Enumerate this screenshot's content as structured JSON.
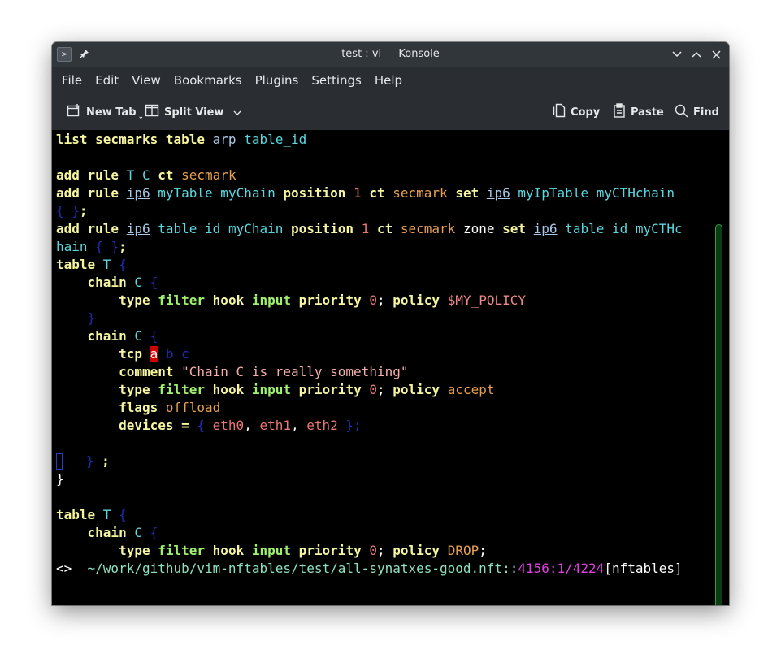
{
  "window": {
    "title": "test : vi — Konsole"
  },
  "menubar": {
    "items": [
      "File",
      "Edit",
      "View",
      "Bookmarks",
      "Plugins",
      "Settings",
      "Help"
    ]
  },
  "toolbar": {
    "new_tab": "New Tab",
    "split_view": "Split View",
    "copy": "Copy",
    "paste": "Paste",
    "find": "Find"
  },
  "terminal": {
    "lines": [
      [
        [
          "kw",
          "list secmarks table "
        ],
        [
          "fam",
          "arp"
        ],
        [
          "",
          ""
        ],
        [
          "id",
          " table_id"
        ]
      ],
      [],
      [
        [
          "kw",
          "add rule "
        ],
        [
          "id",
          "T C "
        ],
        [
          "kw",
          "ct "
        ],
        [
          "sm",
          "secmark"
        ]
      ],
      [
        [
          "kw",
          "add rule "
        ],
        [
          "fam",
          "ip6"
        ],
        [
          "id",
          " myTable myChain "
        ],
        [
          "kw",
          "position "
        ],
        [
          "num",
          "1 "
        ],
        [
          "kw",
          "ct "
        ],
        [
          "sm",
          "secmark "
        ],
        [
          "kw",
          "set "
        ],
        [
          "fam",
          "ip6"
        ],
        [
          "id",
          " myIpTable myCTHchain"
        ]
      ],
      [
        [
          "br",
          "{ }"
        ],
        [
          "kw",
          ";"
        ]
      ],
      [
        [
          "kw",
          "add rule "
        ],
        [
          "fam",
          "ip6"
        ],
        [
          "id",
          " table_id myChain "
        ],
        [
          "kw",
          "position "
        ],
        [
          "num",
          "1 "
        ],
        [
          "kw",
          "ct "
        ],
        [
          "sm",
          "secmark "
        ],
        [
          "wht",
          "zone "
        ],
        [
          "kw",
          "set "
        ],
        [
          "fam",
          "ip6"
        ],
        [
          "id",
          " table_id myCTHc"
        ]
      ],
      [
        [
          "id",
          "hain "
        ],
        [
          "br",
          "{ }"
        ],
        [
          "kw",
          ";"
        ]
      ],
      [
        [
          "kw",
          "table "
        ],
        [
          "id",
          "T "
        ],
        [
          "br",
          "{"
        ]
      ],
      [
        [
          "",
          "    "
        ],
        [
          "kw",
          "chain "
        ],
        [
          "id",
          "C "
        ],
        [
          "br",
          "{"
        ]
      ],
      [
        [
          "",
          "        "
        ],
        [
          "kw",
          "type "
        ],
        [
          "grn",
          "filter "
        ],
        [
          "kw",
          "hook "
        ],
        [
          "grn",
          "input "
        ],
        [
          "kw",
          "priority "
        ],
        [
          "num",
          "0"
        ],
        [
          "wht",
          "; "
        ],
        [
          "kw",
          "policy "
        ],
        [
          "var",
          "$MY_POLICY"
        ]
      ],
      [
        [
          "",
          "    "
        ],
        [
          "br",
          "}"
        ]
      ],
      [
        [
          "",
          "    "
        ],
        [
          "kw",
          "chain "
        ],
        [
          "id",
          "C "
        ],
        [
          "br",
          "{"
        ]
      ],
      [
        [
          "",
          "        "
        ],
        [
          "kw",
          "tcp "
        ],
        [
          "cursor",
          "a"
        ],
        [
          "br",
          " b c"
        ]
      ],
      [
        [
          "",
          "        "
        ],
        [
          "kw",
          "comment "
        ],
        [
          "str",
          "\"Chain C is really something\""
        ]
      ],
      [
        [
          "",
          "        "
        ],
        [
          "kw",
          "type "
        ],
        [
          "grn",
          "filter "
        ],
        [
          "kw",
          "hook "
        ],
        [
          "grn",
          "input "
        ],
        [
          "kw",
          "priority "
        ],
        [
          "num",
          "0"
        ],
        [
          "wht",
          "; "
        ],
        [
          "kw",
          "policy "
        ],
        [
          "sm",
          "accept"
        ]
      ],
      [
        [
          "",
          "        "
        ],
        [
          "kw",
          "flags "
        ],
        [
          "sm",
          "offload"
        ]
      ],
      [
        [
          "",
          "        "
        ],
        [
          "kw",
          "devices = "
        ],
        [
          "br",
          "{ "
        ],
        [
          "num",
          "eth0"
        ],
        [
          "wht",
          ", "
        ],
        [
          "num",
          "eth1"
        ],
        [
          "wht",
          ", "
        ],
        [
          "num",
          "eth2"
        ],
        [
          "br",
          " };"
        ]
      ],
      [],
      [
        [
          "bcur",
          ""
        ],
        [
          "",
          "   "
        ],
        [
          "br",
          "}"
        ],
        [
          "kw",
          " ;"
        ]
      ],
      [
        [
          "wht",
          "}"
        ]
      ],
      [],
      [
        [
          "kw",
          "table "
        ],
        [
          "id",
          "T "
        ],
        [
          "br",
          "{"
        ]
      ],
      [
        [
          "",
          "    "
        ],
        [
          "kw",
          "chain "
        ],
        [
          "id",
          "C "
        ],
        [
          "br",
          "{"
        ]
      ],
      [
        [
          "",
          "        "
        ],
        [
          "kw",
          "type "
        ],
        [
          "grn",
          "filter "
        ],
        [
          "kw",
          "hook "
        ],
        [
          "grn",
          "input "
        ],
        [
          "kw",
          "priority "
        ],
        [
          "num",
          "0"
        ],
        [
          "wht",
          "; "
        ],
        [
          "kw",
          "policy "
        ],
        [
          "sm",
          "DROP"
        ],
        [
          "wht",
          ";"
        ]
      ]
    ],
    "status": {
      "marker": "<>",
      "path": "~/work/github/vim-nftables/test/all-synatxes-good.nft::",
      "position": "4156:1/4224",
      "filetype": "[nftables]"
    }
  }
}
